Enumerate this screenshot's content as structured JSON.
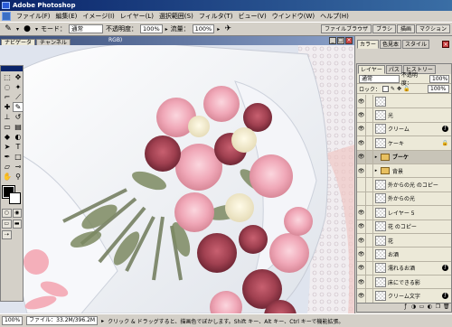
{
  "app": {
    "title": "Adobe Photoshop"
  },
  "menu": [
    "ファイル(F)",
    "編集(E)",
    "イメージ(I)",
    "レイヤー(L)",
    "選択範囲(S)",
    "フィルタ(T)",
    "ビュー(V)",
    "ウインドウ(W)",
    "ヘルプ(H)"
  ],
  "options": {
    "mode_label": "モード：",
    "mode_value": "通常",
    "opacity_label": "不透明度：",
    "opacity_value": "100%",
    "flow_label": "流量：",
    "flow_value": "100%"
  },
  "palette_well": [
    "ファイルブラウザ",
    "ブラシ",
    "描画",
    "マクション"
  ],
  "document": {
    "title": "RGB)"
  },
  "navigator_tabs": [
    "ナビゲータ",
    "チャンネル"
  ],
  "color_tabs": [
    "カラー",
    "色見本",
    "スタイル"
  ],
  "layers": {
    "tabs": [
      "レイヤー",
      "パス",
      "ヒストリー"
    ],
    "blend_mode": "通常",
    "opacity_label": "不透明度：",
    "opacity_value": "100%",
    "lock_label": "ロック：",
    "fill_value": "100%",
    "items": [
      {
        "name": "",
        "kind": "layer",
        "visible": true,
        "selected": false
      },
      {
        "name": "光",
        "kind": "layer",
        "visible": true,
        "selected": false
      },
      {
        "name": "クリーム",
        "kind": "layer",
        "visible": true,
        "selected": false,
        "fx": true
      },
      {
        "name": "ケーキ",
        "kind": "layer",
        "visible": true,
        "selected": false,
        "locked": true
      },
      {
        "name": "ブーケ",
        "kind": "folder",
        "visible": true,
        "selected": true
      },
      {
        "name": "背景",
        "kind": "folder",
        "visible": true,
        "selected": false
      },
      {
        "name": "外からの光 のコピー",
        "kind": "layer",
        "visible": false,
        "selected": false
      },
      {
        "name": "外からの光",
        "kind": "layer",
        "visible": false,
        "selected": false
      },
      {
        "name": "レイヤー 5",
        "kind": "layer",
        "visible": true,
        "selected": false
      },
      {
        "name": "花 のコピー",
        "kind": "layer",
        "visible": true,
        "selected": false
      },
      {
        "name": "花",
        "kind": "layer",
        "visible": true,
        "selected": false
      },
      {
        "name": "お酒",
        "kind": "layer",
        "visible": true,
        "selected": false
      },
      {
        "name": "濡れるお酒",
        "kind": "layer",
        "visible": true,
        "selected": false,
        "fx": true
      },
      {
        "name": "床にできる影",
        "kind": "layer",
        "visible": true,
        "selected": false
      },
      {
        "name": "クリーム文字",
        "kind": "layer",
        "visible": true,
        "selected": false,
        "fx": true
      }
    ]
  },
  "status": {
    "zoom": "100%",
    "file_info": "ファイル：33.2M/396.2M",
    "hint": "クリック & ドラッグすると、描画色でぼかします。Shift キー、Alt キー、Ctrl キーで機能拡張。"
  },
  "colors": {
    "foreground": "#000000",
    "background": "#ffffff",
    "title_gradient_start": "#0a246a",
    "panel_gray": "#d4d0c8"
  }
}
